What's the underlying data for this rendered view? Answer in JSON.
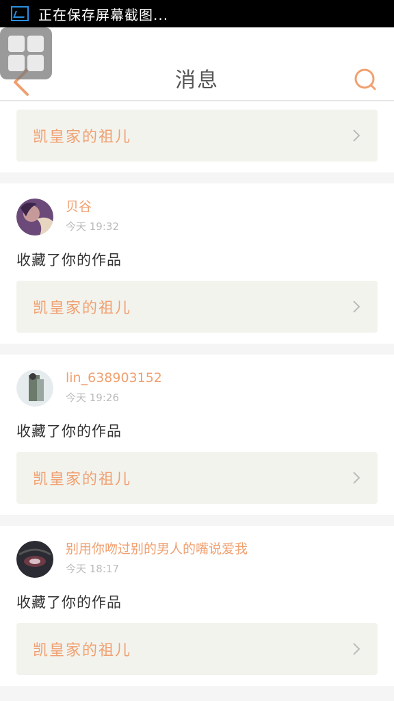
{
  "statusbar": {
    "text": "正在保存屏幕截图..."
  },
  "header": {
    "title": "消息"
  },
  "top_card": {
    "work_title": "凯皇家的祖儿"
  },
  "messages": [
    {
      "username": "贝谷",
      "time": "今天 19:32",
      "action": "收藏了你的作品",
      "work_title": "凯皇家的祖儿"
    },
    {
      "username": "lin_638903152",
      "time": "今天 19:26",
      "action": "收藏了你的作品",
      "work_title": "凯皇家的祖儿"
    },
    {
      "username": "别用你吻过别的男人的嘴说爱我",
      "time": "今天 18:17",
      "action": "收藏了你的作品",
      "work_title": "凯皇家的祖儿"
    }
  ],
  "colors": {
    "accent": "#f0a070",
    "header_bg": "#ffffff",
    "work_box_bg": "#f3f3ee"
  }
}
